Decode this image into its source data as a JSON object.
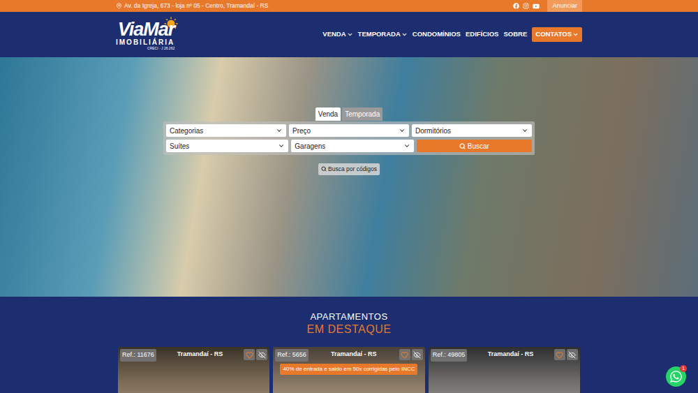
{
  "topbar": {
    "address": "Av. da Igreja, 673 - loja nº 05 - Centro, Tramandaí - RS",
    "button": "Anunciar"
  },
  "logo": {
    "name": "ViaMar",
    "subtitle": "IMOBILIÁRIA",
    "creci": "CRECI - J 26.262"
  },
  "nav": [
    {
      "label": "VENDA",
      "dropdown": true,
      "highlighted": false
    },
    {
      "label": "TEMPORADA",
      "dropdown": true,
      "highlighted": false
    },
    {
      "label": "CONDOMÍNIOS",
      "dropdown": false,
      "highlighted": false
    },
    {
      "label": "EDIFÍCIOS",
      "dropdown": false,
      "highlighted": false
    },
    {
      "label": "SOBRE",
      "dropdown": false,
      "highlighted": false
    },
    {
      "label": "CONTATOS",
      "dropdown": true,
      "highlighted": true
    }
  ],
  "search": {
    "tabs": [
      {
        "label": "Venda",
        "selected": true
      },
      {
        "label": "Temporada",
        "selected": false
      }
    ],
    "fields": [
      "Categorias",
      "Preço",
      "Dormitórios",
      "Suítes",
      "Garagens"
    ],
    "button": "Buscar",
    "code_search": "Busca por códigos"
  },
  "featured": {
    "title": "APARTAMENTOS",
    "subtitle": "EM DESTAQUE",
    "cards": [
      {
        "ref": "Ref.: 11676",
        "location": "Tramandaí - RS",
        "banner": null
      },
      {
        "ref": "Ref.: 5656",
        "location": "Tramandaí - RS",
        "banner": "40% de entrada e saldo em 50x corrigidas pelo INCC"
      },
      {
        "ref": "Ref.: 49805",
        "location": "Tramandaí - RS",
        "banner": null
      }
    ]
  },
  "whatsapp": {
    "badge": "1"
  }
}
